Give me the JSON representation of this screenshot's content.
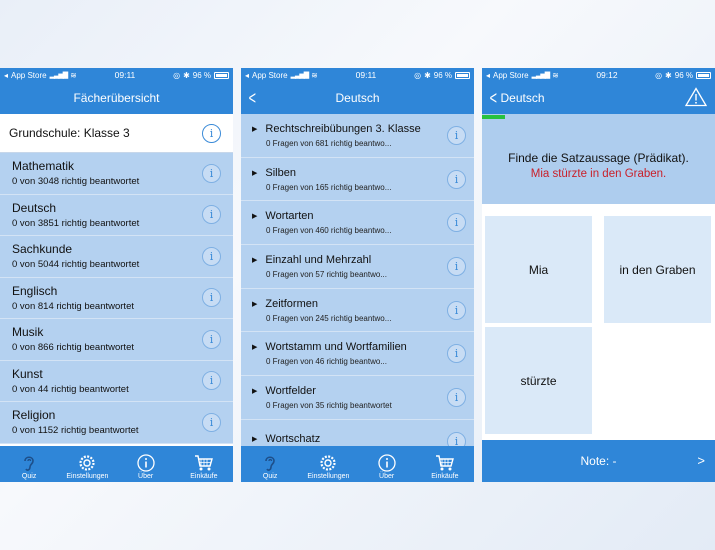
{
  "status": {
    "carrier": "App Store",
    "battery": "96 %",
    "times": [
      "09:11",
      "09:11",
      "09:12"
    ]
  },
  "screen1": {
    "title": "Fächerübersicht",
    "section": "Grundschule: Klasse 3",
    "subjects": [
      {
        "name": "Mathematik",
        "sub": "0 von 3048 richtig beantwortet"
      },
      {
        "name": "Deutsch",
        "sub": "0 von 3851 richtig beantwortet"
      },
      {
        "name": "Sachkunde",
        "sub": "0 von 5044 richtig beantwortet"
      },
      {
        "name": "Englisch",
        "sub": "0 von 814 richtig beantwortet"
      },
      {
        "name": "Musik",
        "sub": "0 von 866 richtig beantwortet"
      },
      {
        "name": "Kunst",
        "sub": "0 von 44 richtig beantwortet"
      },
      {
        "name": "Religion",
        "sub": "0 von 1152 richtig beantwortet"
      }
    ]
  },
  "screen2": {
    "title": "Deutsch",
    "topics": [
      {
        "name": "Rechtschreibübungen 3. Klasse",
        "sub": "0 Fragen von 681 richtig beantwo..."
      },
      {
        "name": "Silben",
        "sub": "0 Fragen von 165 richtig beantwo..."
      },
      {
        "name": "Wortarten",
        "sub": "0 Fragen von 460 richtig beantwo..."
      },
      {
        "name": "Einzahl und Mehrzahl",
        "sub": "0 Fragen von 57 richtig beantwo..."
      },
      {
        "name": "Zeitformen",
        "sub": "0 Fragen von 245 richtig beantwo..."
      },
      {
        "name": "Wortstamm und Wortfamilien",
        "sub": "0 Fragen von 46 richtig beantwo..."
      },
      {
        "name": "Wortfelder",
        "sub": "0 Fragen von 35 richtig beantwortet"
      },
      {
        "name": "Wortschatz",
        "sub": ""
      }
    ]
  },
  "screen3": {
    "back_label": "Deutsch",
    "question": "Finde die Satzaussage (Prädikat).",
    "sentence": "Mia stürzte in den Graben.",
    "answers": [
      "Mia",
      "in den Graben",
      "stürzte"
    ],
    "note_label": "Note: -",
    "next_label": ">",
    "progress": 0.1
  },
  "tabs": [
    {
      "label": "Quiz",
      "icon": "ear-icon"
    },
    {
      "label": "Einstellungen",
      "icon": "gear-icon"
    },
    {
      "label": "Über",
      "icon": "info-icon"
    },
    {
      "label": "Einkäufe",
      "icon": "cart-icon"
    }
  ],
  "colors": {
    "accent": "#2f86d8",
    "row_bg": "#b4d1f0",
    "sentence_red": "#c9202a",
    "progress_green": "#27c23f"
  }
}
